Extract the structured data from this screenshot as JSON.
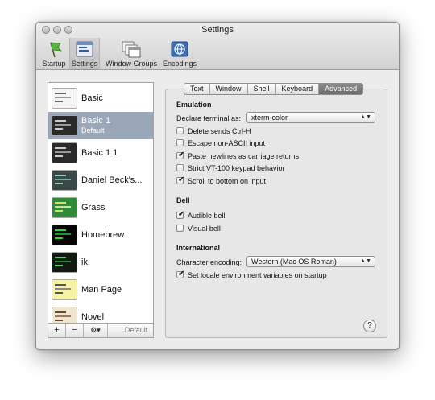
{
  "window": {
    "title": "Settings"
  },
  "toolbar": {
    "items": [
      {
        "label": "Startup",
        "icon": "startup-flag-icon"
      },
      {
        "label": "Settings",
        "icon": "settings-window-icon",
        "selected": true
      },
      {
        "label": "Window Groups",
        "icon": "window-groups-icon"
      },
      {
        "label": "Encodings",
        "icon": "encodings-globe-icon"
      }
    ]
  },
  "sidebar": {
    "profiles": [
      {
        "name": "Basic",
        "theme": "basic-light"
      },
      {
        "name": "Basic 1",
        "subtitle": "Default",
        "theme": "basic-dark",
        "selected": true
      },
      {
        "name": "Basic 1 1",
        "theme": "basic-dark"
      },
      {
        "name": "Daniel Beck's...",
        "theme": "teal-dark"
      },
      {
        "name": "Grass",
        "theme": "green"
      },
      {
        "name": "Homebrew",
        "theme": "black-green"
      },
      {
        "name": "ik",
        "theme": "black-green"
      },
      {
        "name": "Man Page",
        "theme": "yellow"
      },
      {
        "name": "Novel",
        "theme": "beige"
      }
    ],
    "buttons": {
      "add": "+",
      "remove": "−",
      "action": "⚙▾",
      "default": "Default"
    }
  },
  "tabs": [
    {
      "label": "Text"
    },
    {
      "label": "Window"
    },
    {
      "label": "Shell"
    },
    {
      "label": "Keyboard"
    },
    {
      "label": "Advanced",
      "active": true
    }
  ],
  "emulation": {
    "heading": "Emulation",
    "declare_label": "Declare terminal as:",
    "declare_value": "xterm-color",
    "options": [
      {
        "label": "Delete sends Ctrl-H",
        "checked": false
      },
      {
        "label": "Escape non-ASCII input",
        "checked": false
      },
      {
        "label": "Paste newlines as carriage returns",
        "checked": true
      },
      {
        "label": "Strict VT-100 keypad behavior",
        "checked": false
      },
      {
        "label": "Scroll to bottom on input",
        "checked": true
      }
    ]
  },
  "bell": {
    "heading": "Bell",
    "options": [
      {
        "label": "Audible bell",
        "checked": true
      },
      {
        "label": "Visual bell",
        "checked": false
      }
    ]
  },
  "international": {
    "heading": "International",
    "encoding_label": "Character encoding:",
    "encoding_value": "Western (Mac OS Roman)",
    "locale": {
      "label": "Set locale environment variables on startup",
      "checked": true
    }
  },
  "help": "?",
  "colors": {
    "selection": "#9aa7b9",
    "tab_active": "#7a7a7a"
  }
}
